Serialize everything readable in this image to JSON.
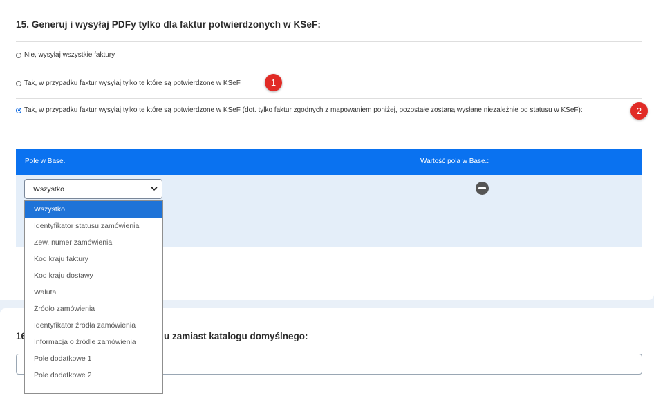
{
  "section15": {
    "title": "15. Generuj i wysyłaj PDFy tylko dla faktur potwierdzonych w KSeF:",
    "options": [
      {
        "label": "Nie, wysyłaj wszystkie faktury",
        "checked": false
      },
      {
        "label": "Tak, w przypadku faktur wysyłaj tylko te które są potwierdzone w KSeF",
        "checked": false,
        "badge": "1"
      },
      {
        "label": "Tak, w przypadku faktur wysyłaj tylko te które są potwierdzone w KSeF (dot. tylko faktur zgodnych z mapowaniem poniżej, pozostałe zostaną wysłane niezależnie od statusu w KSeF):",
        "checked": true,
        "badge": "2"
      }
    ]
  },
  "mapping_table": {
    "col1": "Pole w Base.",
    "col2": "Wartość pola w Base.:",
    "select_value": "Wszystko",
    "dropdown_options": [
      "Wszystko",
      "Identyfikator statusu zamówienia",
      "Zew. numer zamówienia",
      "Kod kraju faktury",
      "Kod kraju dostawy",
      "Waluta",
      "Źródło zamówienia",
      "Identyfikator źródła zamówienia",
      "Informacja o źródle zamówienia",
      "Pole dodatkowe 1",
      "Pole dodatkowe 2"
    ]
  },
  "section16": {
    "title_start": "16",
    "title_end": "u zamiast katalogu domyślnego:"
  },
  "colors": {
    "accent_blue": "#0a72f0",
    "badge_red": "#e12b26",
    "selected_option": "#1e73d8"
  }
}
